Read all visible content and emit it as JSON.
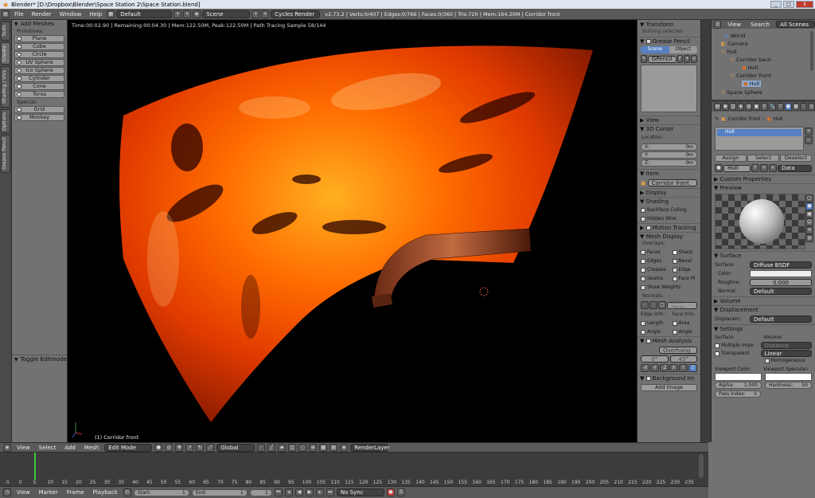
{
  "window": {
    "title": "Blender* [D:\\Dropbox\\Blender\\Space Station 2\\Space Station.blend]",
    "buttons": [
      "_",
      "□",
      "X"
    ]
  },
  "menubar": {
    "menus": [
      "File",
      "Render",
      "Window",
      "Help"
    ],
    "screen_layout": "Default",
    "scene": "Scene",
    "engine": "Cycles Render",
    "stats": "v2.73.2 | Verts:0/407 | Edges:0/766 | Faces:0/360 | Tris:720 | Mem:164.20M | Corridor front"
  },
  "left_tabs": [
    "Tools",
    "Create",
    "Shading / UVs",
    "Options",
    "Grease Pencil"
  ],
  "tool_shelf": {
    "header": "Add Meshes",
    "primitives_label": "Primitives:",
    "primitives": [
      "Plane",
      "Cube",
      "Circle",
      "UV Sphere",
      "Ico Sphere",
      "Cylinder",
      "Cone",
      "Torus"
    ],
    "special_label": "Special:",
    "special": [
      "Grid",
      "Monkey"
    ],
    "toggle_label": "Toggle Editmode"
  },
  "viewport": {
    "render_info": "Time:00:02.90 | Remaining:00:04.30 | Mem:122.50M, Peak:122.50M | Path Tracing Sample 58/144",
    "object_label": "(1) Corridor front"
  },
  "n_panel": {
    "transform": {
      "title": "Transform",
      "empty": "Nothing selected"
    },
    "grease": {
      "title": "Grease Pencil",
      "tabs": [
        "Scene",
        "Object"
      ],
      "layer": "GPencil",
      "flag": "F"
    },
    "view_title": "View",
    "cursor": {
      "title": "3D Cursor",
      "location_label": "Location:",
      "x": "X:",
      "y": "Y:",
      "z": "Z:",
      "x_val": "0m",
      "y_val": "0m",
      "z_val": "0m"
    },
    "item": {
      "title": "Item",
      "name": "Corridor front"
    },
    "display_title": "Display",
    "shading": {
      "title": "Shading",
      "options": [
        "Backface Culling",
        "Hidden Wire"
      ]
    },
    "motion_title": "Motion Tracking",
    "mesh_display": {
      "title": "Mesh Display",
      "overlays_label": "Overlays:",
      "left": [
        "Faces",
        "Edges",
        "Creases",
        "Seams",
        "Show Weights"
      ],
      "right": [
        "Sharp",
        "Bevel",
        "Edge",
        "Face M"
      ],
      "normals_label": "Normals:",
      "normals_size": "Size: 10cm",
      "edge_info": "Edge Info:",
      "face_info": "Face Info:",
      "info_left": [
        "Length",
        "Angle"
      ],
      "info_right": [
        "Area",
        "Angle"
      ]
    },
    "mesh_analysis": {
      "title": "Mesh Analysis",
      "type": "Overhang",
      "min": "0°",
      "max": "45°",
      "axes": [
        "-X",
        "-Y",
        "-Z",
        "X",
        "Y",
        "Z"
      ]
    },
    "background": {
      "title": "Background Im",
      "add": "Add Image"
    }
  },
  "outliner": {
    "menu": [
      "View",
      "Search"
    ],
    "scope": "All Scenes",
    "items": [
      "World",
      "Camera",
      "Hull",
      "Corridor back",
      "Hull",
      "Corridor front",
      "Hull",
      "Space Sphere"
    ]
  },
  "properties": {
    "breadcrumb": [
      "Corridor front",
      "Hull"
    ],
    "slot": "Hull",
    "assign_buttons": [
      "Assign",
      "Select",
      "Deselect"
    ],
    "material_name": "Hull",
    "material_flag": "F",
    "data_menu": "Data",
    "custom_props": "Custom Properties",
    "preview_title": "Preview",
    "surface": {
      "title": "Surface",
      "label": "Surface:",
      "shader": "Diffuse BSDF",
      "color": "Color:",
      "roughness": "Roughne:",
      "roughness_val": "0.000",
      "normal": "Normal:",
      "normal_val": "Default"
    },
    "volume_title": "Volume",
    "displacement": {
      "title": "Displacement",
      "label": "Displacem:",
      "value": "Default"
    },
    "settings": {
      "title": "Settings",
      "surface_label": "Surface:",
      "volume_label": "Volume:",
      "mis": "Multiple Impo",
      "transparent": "Transparent",
      "distance": "Distance",
      "linear": "Linear",
      "homogeneous": "Homogeneous",
      "viewport_color": "Viewport Color:",
      "viewport_specular": "Viewport Specular:",
      "alpha": "Alpha:",
      "alpha_val": "1.000",
      "hardness": "Hardness:",
      "hardness_val": "50",
      "pass_index": "Pass Index:",
      "pass_val": "0"
    }
  },
  "viewport_header": {
    "menus": [
      "View",
      "Select",
      "Add",
      "Mesh"
    ],
    "mode": "Edit Mode",
    "orientation": "Global",
    "render_layer": "RenderLayer"
  },
  "timeline": {
    "ticks": [
      "-5",
      "0",
      "5",
      "10",
      "15",
      "20",
      "25",
      "30",
      "35",
      "40",
      "45",
      "50",
      "55",
      "60",
      "65",
      "70",
      "75",
      "80",
      "85",
      "90",
      "95",
      "100",
      "105",
      "110",
      "115",
      "120",
      "125",
      "130",
      "135",
      "140",
      "145",
      "150",
      "155",
      "160",
      "165",
      "170",
      "175",
      "180",
      "185",
      "190",
      "195",
      "200",
      "205",
      "210",
      "215",
      "220",
      "225",
      "230",
      "235"
    ],
    "current_frame": 1
  },
  "timeline_header": {
    "menus": [
      "View",
      "Marker",
      "Frame",
      "Playback"
    ],
    "start": "Start:",
    "start_val": "1",
    "end": "End:",
    "end_val": "1",
    "frame": "1",
    "sync": "No Sync"
  },
  "colors": {
    "accent": "#5680c2",
    "render_orange": "#ff6a00"
  }
}
